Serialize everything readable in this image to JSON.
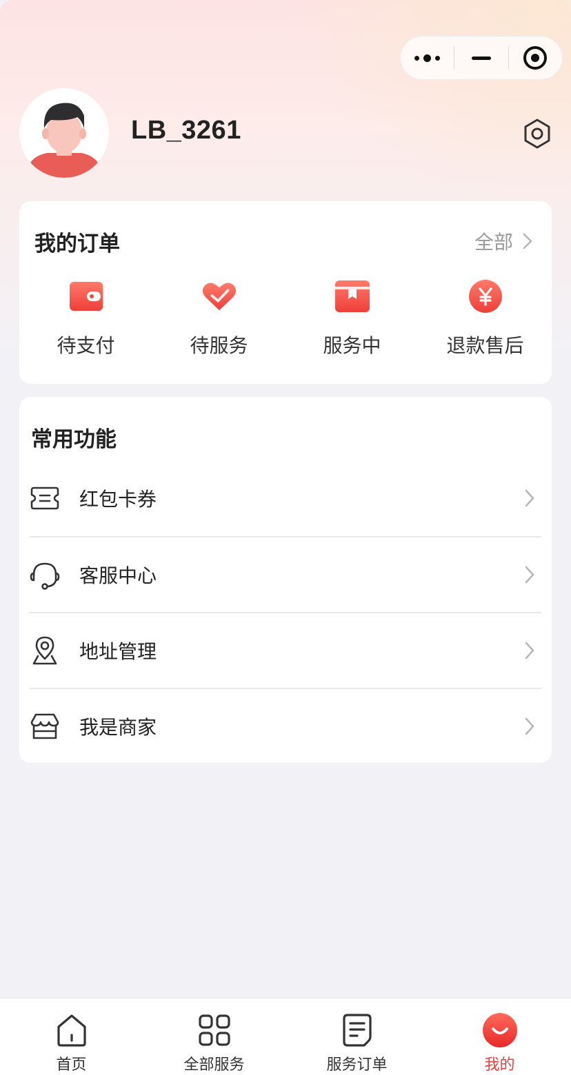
{
  "profile": {
    "username": "LB_3261"
  },
  "orders": {
    "title": "我的订单",
    "view_all": "全部",
    "items": [
      {
        "label": "待支付",
        "icon": "wallet-icon"
      },
      {
        "label": "待服务",
        "icon": "heart-icon"
      },
      {
        "label": "服务中",
        "icon": "box-icon"
      },
      {
        "label": "退款售后",
        "icon": "yen-icon"
      }
    ]
  },
  "functions": {
    "title": "常用功能",
    "items": [
      {
        "label": "红包卡券",
        "icon": "coupon-icon"
      },
      {
        "label": "客服中心",
        "icon": "headset-icon"
      },
      {
        "label": "地址管理",
        "icon": "location-icon"
      },
      {
        "label": "我是商家",
        "icon": "store-icon"
      }
    ]
  },
  "tabbar": {
    "items": [
      {
        "label": "首页",
        "icon": "home-icon"
      },
      {
        "label": "全部服务",
        "icon": "grid-icon"
      },
      {
        "label": "服务订单",
        "icon": "document-icon"
      },
      {
        "label": "我的",
        "icon": "profile-icon",
        "active": true
      }
    ]
  },
  "colors": {
    "accent": "#e8403a",
    "background": "#f2f2f6"
  }
}
